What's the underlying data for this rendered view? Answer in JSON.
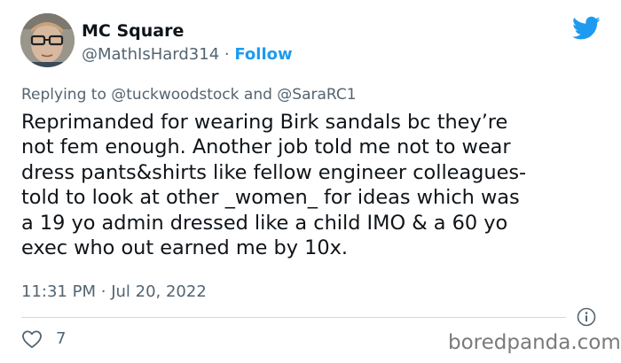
{
  "author": {
    "display_name": "MC Square",
    "handle": "@MathIsHard314",
    "separator": "·",
    "follow_label": "Follow"
  },
  "reply": {
    "prefix": "Replying to",
    "mention_1": "@tuckwoodstock",
    "and": "and",
    "mention_2": "@SaraRC1"
  },
  "tweet": {
    "text": "Reprimanded for wearing Birk sandals bc they’re\nnot fem enough. Another job told me not to wear\ndress pants&shirts like fellow engineer colleagues-\ntold to look at other _women_ for ideas which was\na 19 yo admin dressed like a child IMO & a 60 yo\nexec who out earned me by 10x.",
    "time": "11:31 PM",
    "separator": "·",
    "date": "Jul 20, 2022"
  },
  "engagement": {
    "likes": "7"
  },
  "watermark": "boredpanda.com",
  "icons": {
    "brand": "twitter-bird-icon",
    "info": "info-icon",
    "like": "heart-icon"
  },
  "colors": {
    "accent": "#1d9bf0",
    "secondary_text": "#536471",
    "primary_text": "#0f1419"
  }
}
